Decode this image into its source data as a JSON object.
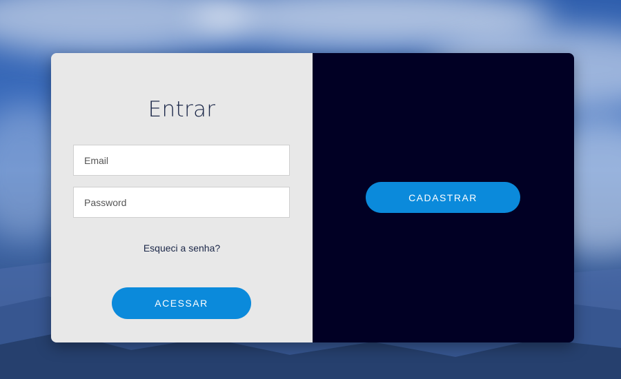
{
  "login": {
    "title": "Entrar",
    "email_placeholder": "Email",
    "email_value": "",
    "password_placeholder": "Password",
    "password_value": "",
    "forgot_label": "Esqueci a senha?",
    "submit_label": "ACESSAR"
  },
  "signup": {
    "button_label": "CADASTRAR"
  },
  "colors": {
    "left_panel": "#e8e8e8",
    "right_panel": "#010024",
    "button": "#0b8adb",
    "title_text": "#1b2748"
  }
}
